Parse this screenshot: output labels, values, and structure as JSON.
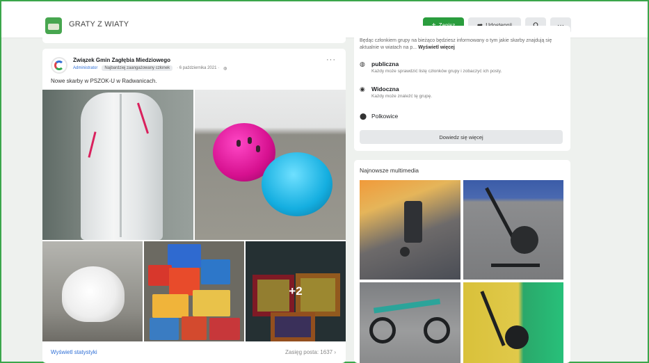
{
  "header": {
    "group_name": "GRATY Z WIATY",
    "join_label": "Zapisz",
    "share_label": "Udostępnij",
    "search_icon": "search-icon",
    "more_icon": "more-icon"
  },
  "post": {
    "author": "Związek Gmin Zagłębia Miedziowego",
    "role": "Administrator",
    "badge": "Najbardziej zaangażowany członek",
    "time": "· 6 października 2021 ·",
    "privacy_icon": "globe-icon",
    "text": "Nowe skarby w PSZOK-U w Radwanicach.",
    "more_photos": "+2",
    "stats_link": "Wyświetl statystyki",
    "reach": "Zasięg posta: 1637"
  },
  "about": {
    "description": "Będąc członkiem grupy na bieżąco będziesz informowany o tym jakie skarby znajdują się aktualnie w wiatach na p...",
    "see_more": "Wyświetl więcej",
    "rows": [
      {
        "icon": "globe-icon",
        "title": "publiczna",
        "desc": "Każdy może sprawdzić listę członków grupy i zobaczyć ich posty."
      },
      {
        "icon": "eye-icon",
        "title": "Widoczna",
        "desc": "Każdy może znaleźć tę grupę."
      },
      {
        "icon": "location-pin-icon",
        "title": "Polkowice",
        "desc": ""
      }
    ],
    "learn_more": "Dowiedz się więcej"
  },
  "media": {
    "title": "Najnowsze multimedia"
  },
  "colors": {
    "accent_green": "#2a9d3d",
    "frame_green": "#3aa64a",
    "link_blue": "#2f6fd6"
  }
}
